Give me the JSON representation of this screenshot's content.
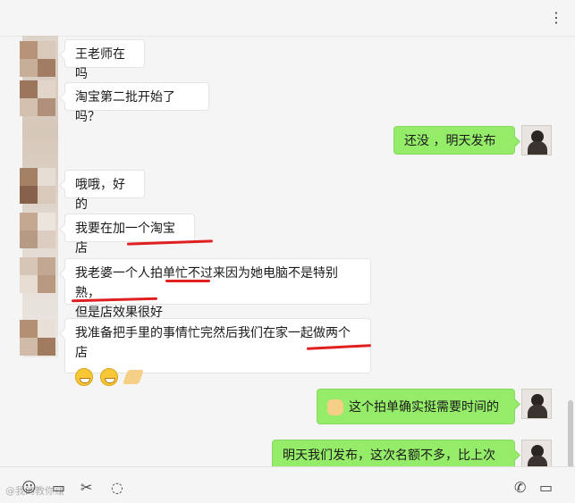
{
  "header": {
    "more_icon": "⋮"
  },
  "messages": [
    {
      "side": "left",
      "text": "王老师在吗"
    },
    {
      "side": "left",
      "text": "淘宝第二批开始了吗？"
    },
    {
      "side": "right",
      "text": "还没  ，明天发布"
    },
    {
      "side": "left",
      "text": "哦哦，好的"
    },
    {
      "side": "left",
      "text": "我要在加一个淘宝店"
    },
    {
      "side": "left",
      "line1": "我老婆一个人拍单忙不过来因为她电脑不是特别熟，",
      "line2": "但是店效果很好"
    },
    {
      "side": "left",
      "text": "我准备把手里的事情忙完然后我们在家一起做两个店"
    },
    {
      "side": "right",
      "text": "这个拍单确实挺需要时间的"
    },
    {
      "side": "right",
      "text": "明天我们发布，这次名额不多，比上次少"
    }
  ],
  "toolbar": {
    "watermark": "@我的教你赚"
  },
  "colors": {
    "me_bubble": "#95ec69",
    "other_bubble": "#ffffff",
    "annotation": "#e02020"
  },
  "icons": [
    "more-icon",
    "smiley-icon",
    "folder-icon",
    "scissors-icon",
    "chat-bubble-icon",
    "phone-icon",
    "video-icon"
  ]
}
